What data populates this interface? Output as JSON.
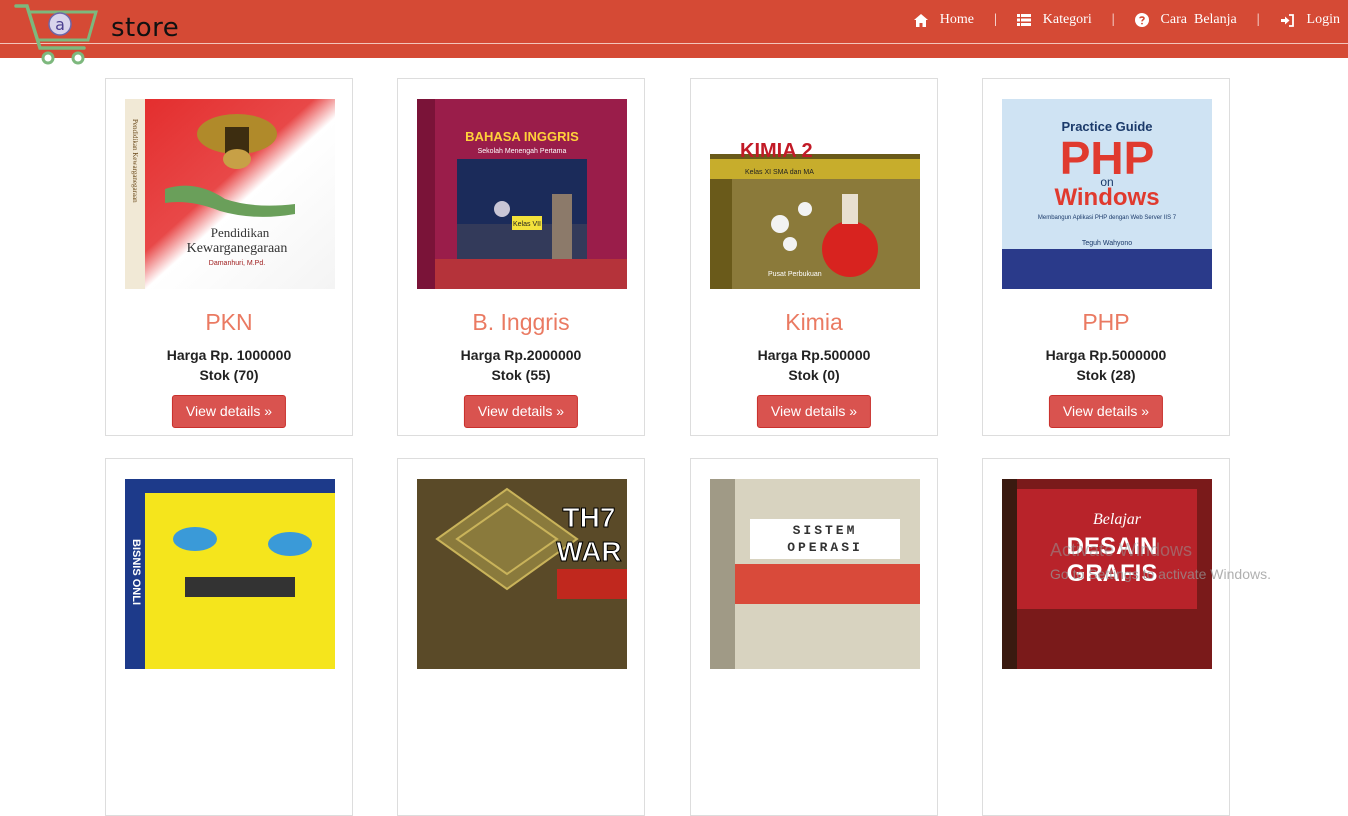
{
  "brand": {
    "name": "store",
    "logo_letter": "a",
    "logo": "shopping-cart-logo"
  },
  "nav": {
    "items": [
      {
        "label": "Home",
        "icon": "home-icon"
      },
      {
        "label": "Kategori",
        "icon": "list-icon"
      },
      {
        "label": "Cara  Belanja",
        "icon": "question-circle-icon"
      },
      {
        "label": "Login",
        "icon": "login-icon"
      }
    ],
    "separator": "|"
  },
  "products": [
    {
      "title": "PKN",
      "price": "Harga Rp. 1000000",
      "stock": "Stok (70)",
      "button": "View details »",
      "cover": {
        "heading": "Pendidikan",
        "subheading": "Kewarganegaraan",
        "author": "Damanhuri, M.Pd.",
        "spine": "Pendidikan Kewarganegaraan"
      }
    },
    {
      "title": "B. Inggris",
      "price": "Harga Rp.2000000",
      "stock": "Stok (55)",
      "button": "View details »",
      "cover": {
        "heading": "BAHASA INGGRIS",
        "subheading": "Sekolah Menengah Pertama",
        "edition": "Kelas VII"
      }
    },
    {
      "title": "Kimia",
      "price": "Harga Rp.500000",
      "stock": "Stok (0)",
      "button": "View details »",
      "cover": {
        "heading": "KIMIA 2",
        "subheading": "Kelas XI SMA dan MA",
        "publisher": "Pusat Perbukuan"
      }
    },
    {
      "title": "PHP",
      "price": "Harga Rp.5000000",
      "stock": "Stok (28)",
      "button": "View details »",
      "cover": {
        "heading": "Practice Guide",
        "big": "PHP",
        "on": "on",
        "platform": "Windows",
        "subheading": "Membangun Aplikasi PHP dengan Web Server IIS 7",
        "author": "Teguh Wahyono"
      }
    },
    {
      "cover": {
        "spine": "BISNIS ONLI"
      }
    },
    {
      "cover": {
        "line1": "TH7",
        "line2": "WAR"
      }
    },
    {
      "cover": {
        "line1": "SISTEM",
        "line2": "OPERASI"
      }
    },
    {
      "cover": {
        "line1": "Belajar",
        "line2": "DESAIN",
        "line3": "GRAFIS"
      }
    }
  ],
  "watermark": {
    "line1": "Activate Windows",
    "line2": "Go to Settings to activate Windows."
  }
}
